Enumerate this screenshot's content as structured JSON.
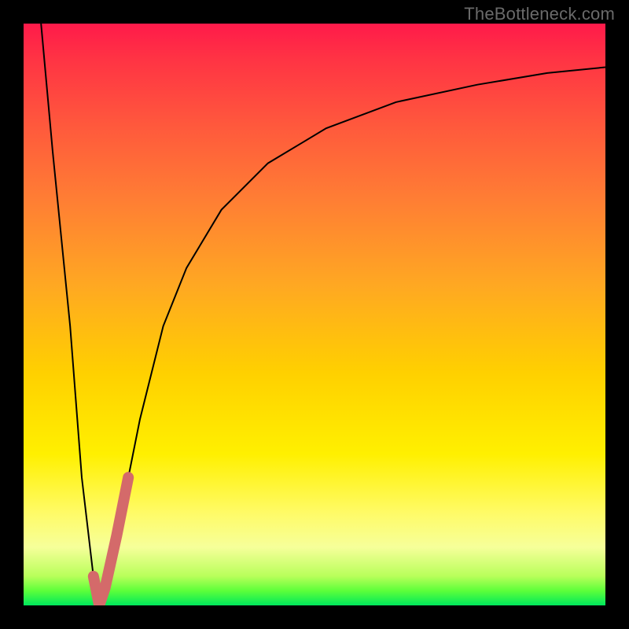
{
  "watermark": {
    "text": "TheBottleneck.com"
  },
  "chart_data": {
    "type": "line",
    "title": "",
    "xlabel": "",
    "ylabel": "",
    "xlim": [
      0,
      100
    ],
    "ylim": [
      0,
      100
    ],
    "gradient_bands": [
      {
        "y": 100,
        "color": "#ff1a4a"
      },
      {
        "y": 60,
        "color": "#ffd000"
      },
      {
        "y": 26,
        "color": "#fff000"
      },
      {
        "y": 6,
        "color": "#b8ff5a"
      },
      {
        "y": 0,
        "color": "#00e85c"
      }
    ],
    "series": [
      {
        "name": "bottleneck-curve",
        "stroke": "#000000",
        "stroke_width": 2,
        "x": [
          3,
          5,
          8,
          10,
          12,
          13,
          14,
          16,
          18,
          20,
          24,
          28,
          34,
          42,
          52,
          64,
          78,
          90,
          100
        ],
        "y": [
          100,
          78,
          48,
          22,
          5,
          0,
          3,
          12,
          22,
          32,
          48,
          58,
          68,
          76,
          82,
          86.5,
          89.5,
          91.5,
          92.5
        ]
      },
      {
        "name": "highlight-segment",
        "stroke": "#d46a6a",
        "stroke_width": 14,
        "linecap": "round",
        "x": [
          12,
          13,
          14,
          16,
          18
        ],
        "y": [
          5,
          0,
          3,
          12,
          22
        ]
      }
    ]
  }
}
